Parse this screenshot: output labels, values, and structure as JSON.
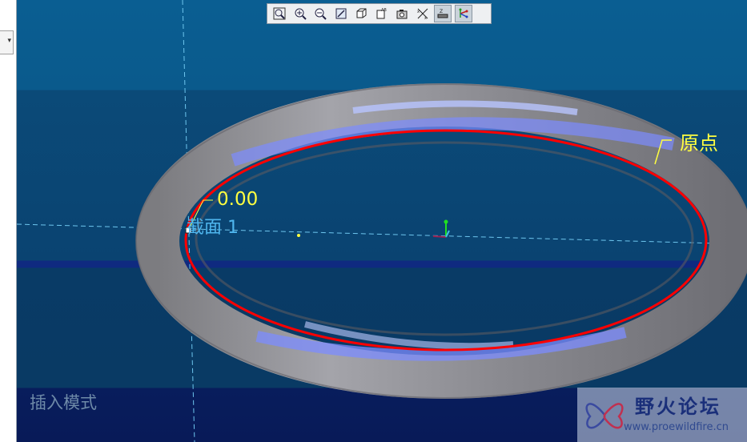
{
  "left_panel": {
    "dropdown_arrow": "▾"
  },
  "toolbar": {
    "buttons": [
      {
        "name": "zoom-window-icon"
      },
      {
        "name": "zoom-in-icon"
      },
      {
        "name": "zoom-out-icon"
      },
      {
        "name": "repaint-icon"
      },
      {
        "name": "display-style-icon"
      },
      {
        "name": "saved-views-icon"
      },
      {
        "name": "named-view-icon"
      },
      {
        "name": "datum-display-icon"
      },
      {
        "name": "datum-points-icon",
        "active": true
      },
      {
        "name": "csys-display-icon",
        "active": true
      }
    ]
  },
  "viewport": {
    "dimension_value": "0.00",
    "section_label": "截面 1",
    "origin_label": "原点",
    "mode_label": "插入模式"
  },
  "watermark": {
    "title": "野火论坛",
    "url": "www.proewildfire.cn"
  },
  "colors": {
    "ring_body": "#8c8c90",
    "ring_highlight": "#7c8cff",
    "trajectory": "#ff0000",
    "dimension_text": "#ffff40",
    "section_text": "#4fb6ee",
    "mode_text": "#6e8aa8"
  }
}
